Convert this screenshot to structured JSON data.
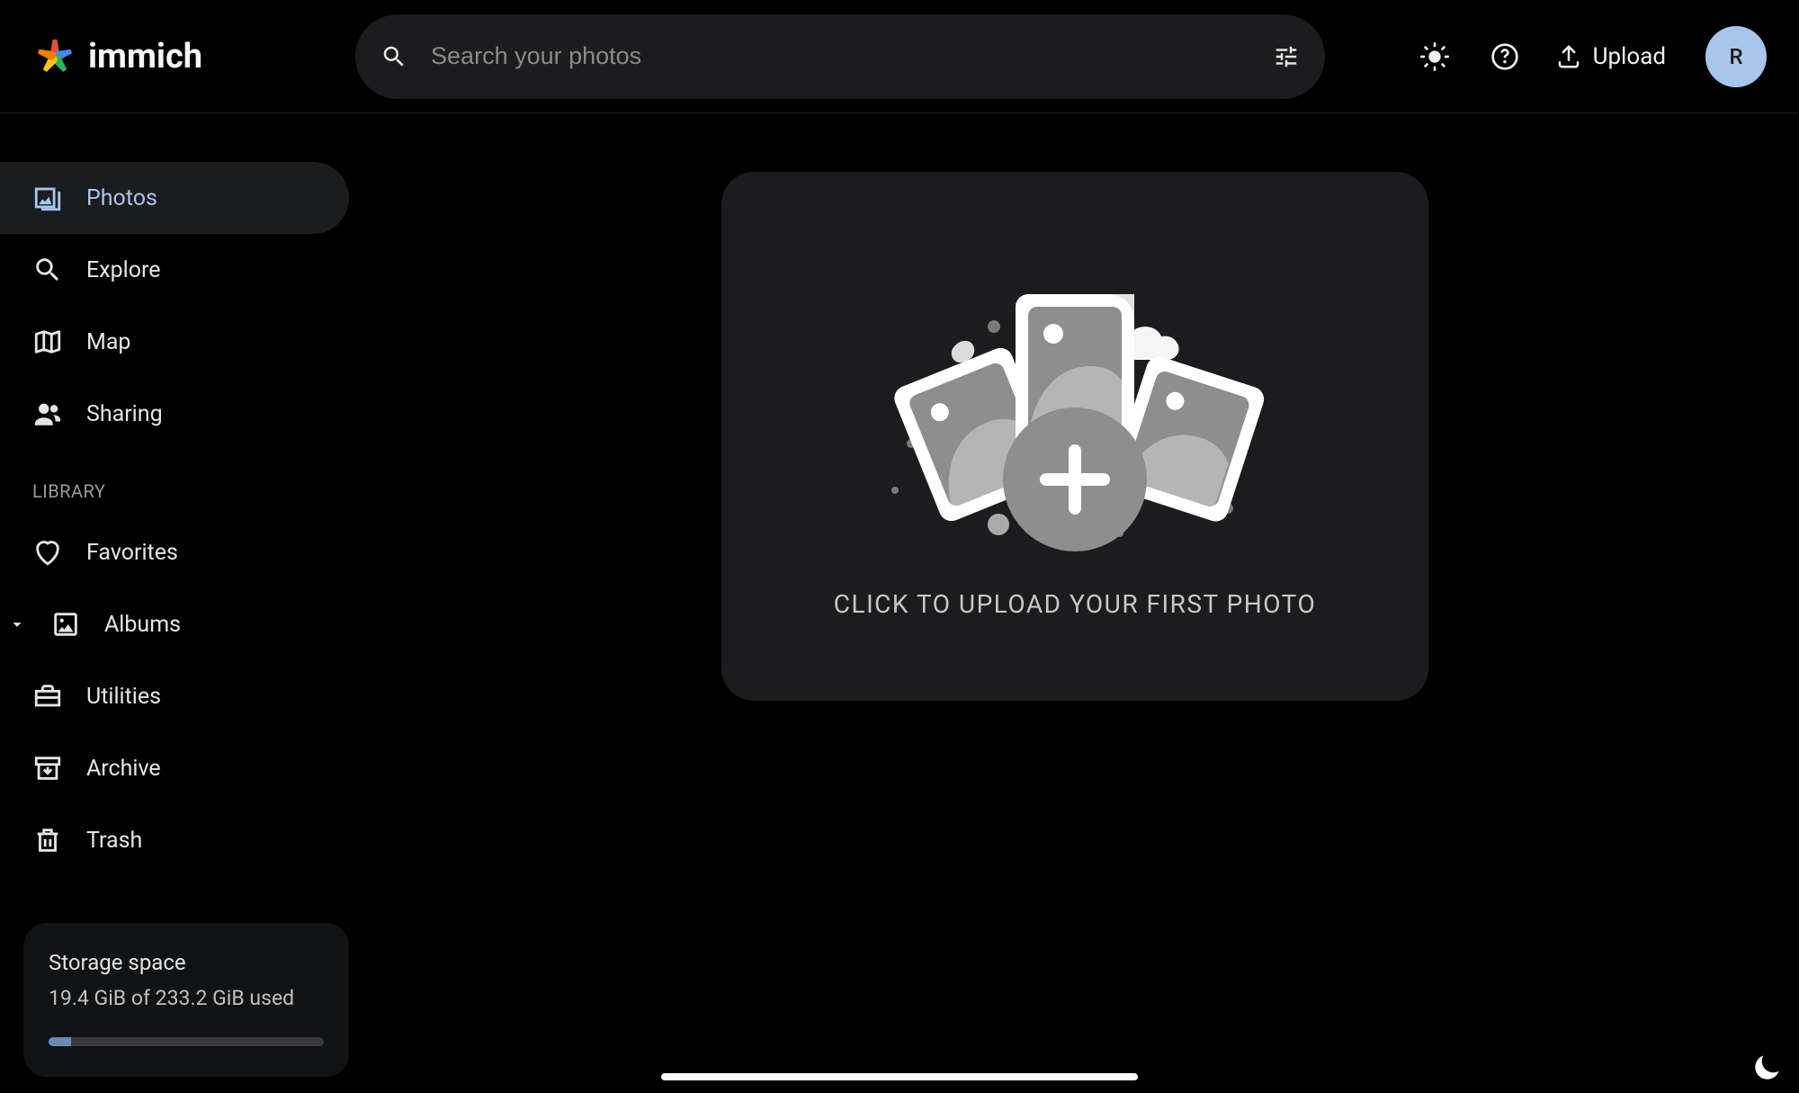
{
  "header": {
    "app_name": "immich",
    "search_placeholder": "Search your photos",
    "upload_label": "Upload",
    "avatar_initial": "R"
  },
  "sidebar": {
    "items_main": [
      {
        "id": "photos",
        "label": "Photos",
        "active": true
      },
      {
        "id": "explore",
        "label": "Explore",
        "active": false
      },
      {
        "id": "map",
        "label": "Map",
        "active": false
      },
      {
        "id": "sharing",
        "label": "Sharing",
        "active": false
      }
    ],
    "section_library": "LIBRARY",
    "items_library": [
      {
        "id": "favorites",
        "label": "Favorites"
      },
      {
        "id": "albums",
        "label": "Albums",
        "expandable": true
      },
      {
        "id": "utilities",
        "label": "Utilities"
      },
      {
        "id": "archive",
        "label": "Archive"
      },
      {
        "id": "trash",
        "label": "Trash"
      }
    ],
    "storage": {
      "title": "Storage space",
      "usage_text": "19.4 GiB of 233.2 GiB used",
      "used_gib": 19.4,
      "total_gib": 233.2,
      "percent": 8.3
    }
  },
  "main": {
    "empty_prompt": "CLICK TO UPLOAD YOUR FIRST PHOTO"
  }
}
